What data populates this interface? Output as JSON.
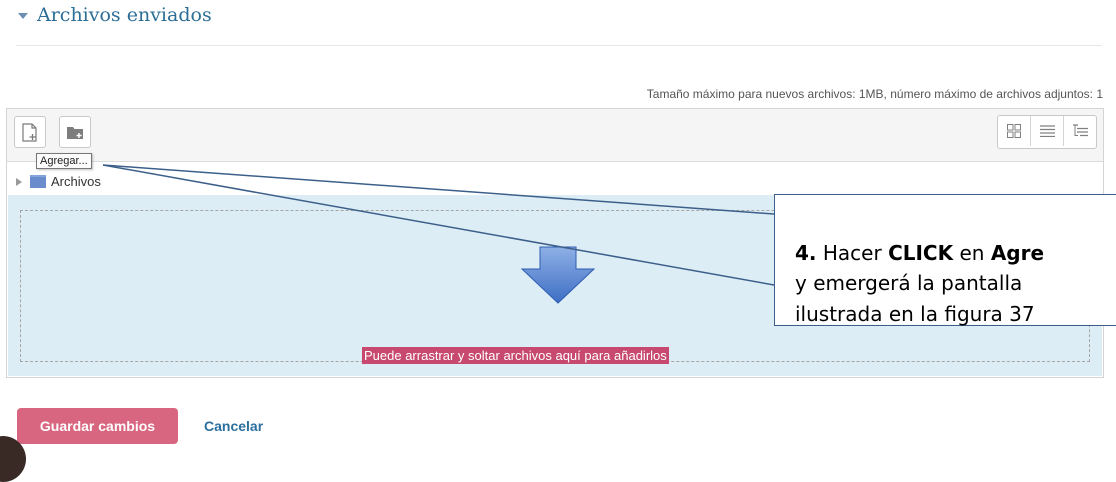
{
  "section": {
    "title": "Archivos enviados"
  },
  "limits_text": "Tamaño máximo para nuevos archivos: 1MB, número máximo de archivos adjuntos: 1",
  "toolbar": {
    "add_icon": "add-file-icon",
    "create_folder_icon": "create-folder-icon",
    "view_icons": [
      "grid-view-icon",
      "list-view-icon",
      "tree-view-icon"
    ],
    "tooltip": "Agregar..."
  },
  "tree": {
    "folder_label": "Archivos"
  },
  "dropzone": {
    "text": "Puede arrastrar y soltar archivos aquí para añadirlos"
  },
  "actions": {
    "save_label": "Guardar cambios",
    "cancel_label": "Cancelar"
  },
  "annotation": {
    "step": "4.",
    "l1_a": "Hacer",
    "l1_b": "CLICK",
    "l1_c": "en",
    "l1_d": "Agre",
    "l2": "y emergerá la pantalla",
    "l3": "ilustrada en la figura 37"
  },
  "colors": {
    "title": "#2c6e95",
    "save_button": "#d96680",
    "dropzone_bg": "#dcedf6",
    "dropzone_text_bg": "#c7496f",
    "annotation_border": "#3c5f8a",
    "cancel_link": "#2a6f9e"
  }
}
